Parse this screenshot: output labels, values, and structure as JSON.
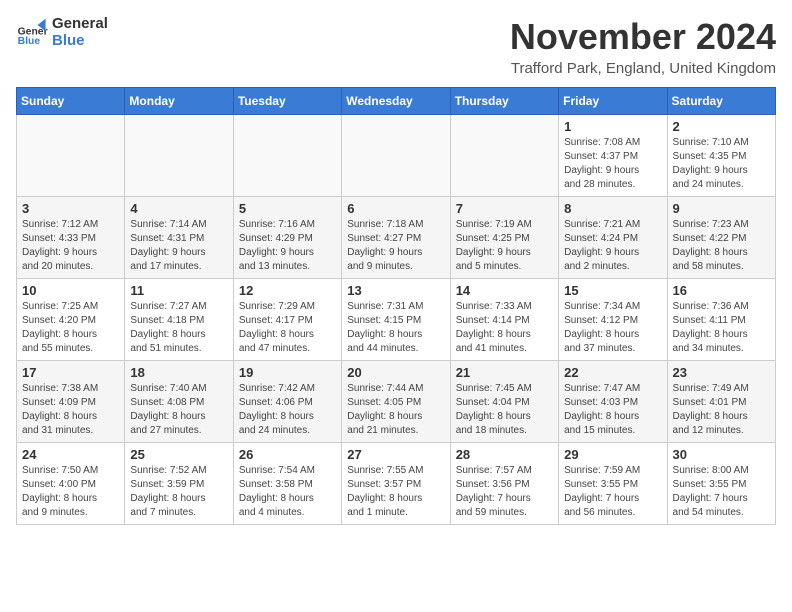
{
  "logo": {
    "general": "General",
    "blue": "Blue"
  },
  "title": "November 2024",
  "location": "Trafford Park, England, United Kingdom",
  "days_of_week": [
    "Sunday",
    "Monday",
    "Tuesday",
    "Wednesday",
    "Thursday",
    "Friday",
    "Saturday"
  ],
  "weeks": [
    [
      {
        "day": "",
        "info": ""
      },
      {
        "day": "",
        "info": ""
      },
      {
        "day": "",
        "info": ""
      },
      {
        "day": "",
        "info": ""
      },
      {
        "day": "",
        "info": ""
      },
      {
        "day": "1",
        "info": "Sunrise: 7:08 AM\nSunset: 4:37 PM\nDaylight: 9 hours\nand 28 minutes."
      },
      {
        "day": "2",
        "info": "Sunrise: 7:10 AM\nSunset: 4:35 PM\nDaylight: 9 hours\nand 24 minutes."
      }
    ],
    [
      {
        "day": "3",
        "info": "Sunrise: 7:12 AM\nSunset: 4:33 PM\nDaylight: 9 hours\nand 20 minutes."
      },
      {
        "day": "4",
        "info": "Sunrise: 7:14 AM\nSunset: 4:31 PM\nDaylight: 9 hours\nand 17 minutes."
      },
      {
        "day": "5",
        "info": "Sunrise: 7:16 AM\nSunset: 4:29 PM\nDaylight: 9 hours\nand 13 minutes."
      },
      {
        "day": "6",
        "info": "Sunrise: 7:18 AM\nSunset: 4:27 PM\nDaylight: 9 hours\nand 9 minutes."
      },
      {
        "day": "7",
        "info": "Sunrise: 7:19 AM\nSunset: 4:25 PM\nDaylight: 9 hours\nand 5 minutes."
      },
      {
        "day": "8",
        "info": "Sunrise: 7:21 AM\nSunset: 4:24 PM\nDaylight: 9 hours\nand 2 minutes."
      },
      {
        "day": "9",
        "info": "Sunrise: 7:23 AM\nSunset: 4:22 PM\nDaylight: 8 hours\nand 58 minutes."
      }
    ],
    [
      {
        "day": "10",
        "info": "Sunrise: 7:25 AM\nSunset: 4:20 PM\nDaylight: 8 hours\nand 55 minutes."
      },
      {
        "day": "11",
        "info": "Sunrise: 7:27 AM\nSunset: 4:18 PM\nDaylight: 8 hours\nand 51 minutes."
      },
      {
        "day": "12",
        "info": "Sunrise: 7:29 AM\nSunset: 4:17 PM\nDaylight: 8 hours\nand 47 minutes."
      },
      {
        "day": "13",
        "info": "Sunrise: 7:31 AM\nSunset: 4:15 PM\nDaylight: 8 hours\nand 44 minutes."
      },
      {
        "day": "14",
        "info": "Sunrise: 7:33 AM\nSunset: 4:14 PM\nDaylight: 8 hours\nand 41 minutes."
      },
      {
        "day": "15",
        "info": "Sunrise: 7:34 AM\nSunset: 4:12 PM\nDaylight: 8 hours\nand 37 minutes."
      },
      {
        "day": "16",
        "info": "Sunrise: 7:36 AM\nSunset: 4:11 PM\nDaylight: 8 hours\nand 34 minutes."
      }
    ],
    [
      {
        "day": "17",
        "info": "Sunrise: 7:38 AM\nSunset: 4:09 PM\nDaylight: 8 hours\nand 31 minutes."
      },
      {
        "day": "18",
        "info": "Sunrise: 7:40 AM\nSunset: 4:08 PM\nDaylight: 8 hours\nand 27 minutes."
      },
      {
        "day": "19",
        "info": "Sunrise: 7:42 AM\nSunset: 4:06 PM\nDaylight: 8 hours\nand 24 minutes."
      },
      {
        "day": "20",
        "info": "Sunrise: 7:44 AM\nSunset: 4:05 PM\nDaylight: 8 hours\nand 21 minutes."
      },
      {
        "day": "21",
        "info": "Sunrise: 7:45 AM\nSunset: 4:04 PM\nDaylight: 8 hours\nand 18 minutes."
      },
      {
        "day": "22",
        "info": "Sunrise: 7:47 AM\nSunset: 4:03 PM\nDaylight: 8 hours\nand 15 minutes."
      },
      {
        "day": "23",
        "info": "Sunrise: 7:49 AM\nSunset: 4:01 PM\nDaylight: 8 hours\nand 12 minutes."
      }
    ],
    [
      {
        "day": "24",
        "info": "Sunrise: 7:50 AM\nSunset: 4:00 PM\nDaylight: 8 hours\nand 9 minutes."
      },
      {
        "day": "25",
        "info": "Sunrise: 7:52 AM\nSunset: 3:59 PM\nDaylight: 8 hours\nand 7 minutes."
      },
      {
        "day": "26",
        "info": "Sunrise: 7:54 AM\nSunset: 3:58 PM\nDaylight: 8 hours\nand 4 minutes."
      },
      {
        "day": "27",
        "info": "Sunrise: 7:55 AM\nSunset: 3:57 PM\nDaylight: 8 hours\nand 1 minute."
      },
      {
        "day": "28",
        "info": "Sunrise: 7:57 AM\nSunset: 3:56 PM\nDaylight: 7 hours\nand 59 minutes."
      },
      {
        "day": "29",
        "info": "Sunrise: 7:59 AM\nSunset: 3:55 PM\nDaylight: 7 hours\nand 56 minutes."
      },
      {
        "day": "30",
        "info": "Sunrise: 8:00 AM\nSunset: 3:55 PM\nDaylight: 7 hours\nand 54 minutes."
      }
    ]
  ]
}
